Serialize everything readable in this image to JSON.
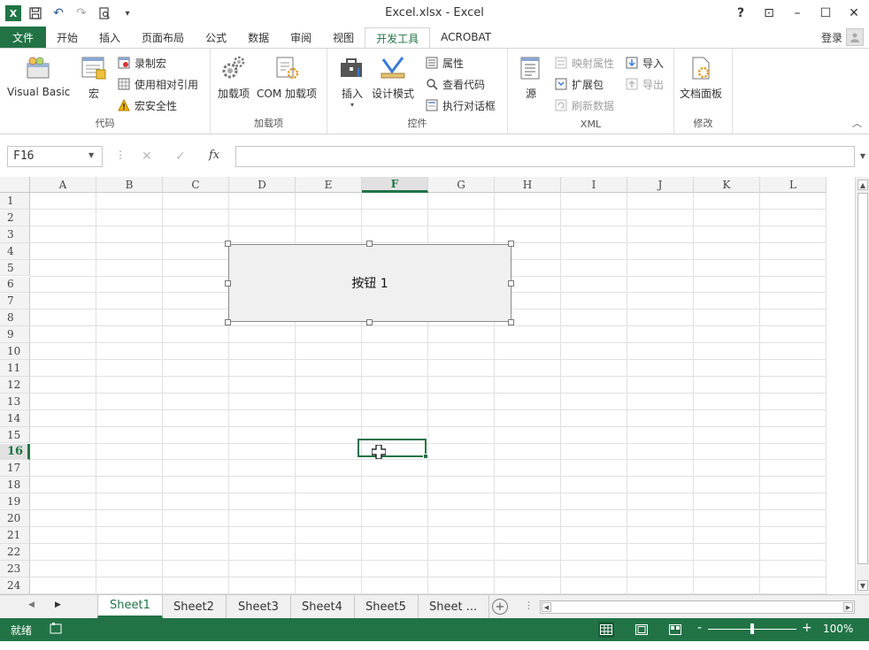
{
  "window": {
    "title": "Excel.xlsx - Excel",
    "controls": [
      "?",
      "⊡",
      "–",
      "☐",
      "✕"
    ]
  },
  "qat": {
    "app_badge": "X",
    "icons": [
      "save-icon",
      "undo-icon",
      "redo-icon",
      "print-preview-icon",
      "customize-qat-icon"
    ]
  },
  "tabs": [
    {
      "label": "文件",
      "kind": "file"
    },
    {
      "label": "开始"
    },
    {
      "label": "插入"
    },
    {
      "label": "页面布局"
    },
    {
      "label": "公式"
    },
    {
      "label": "数据"
    },
    {
      "label": "审阅"
    },
    {
      "label": "视图"
    },
    {
      "label": "开发工具",
      "active": true
    },
    {
      "label": "ACROBAT"
    }
  ],
  "account": {
    "login_label": "登录"
  },
  "ribbon": {
    "groups": {
      "code": {
        "label": "代码",
        "visual_basic": "Visual Basic",
        "macros": "宏",
        "record_macro": "录制宏",
        "relative_ref": "使用相对引用",
        "macro_security": "宏安全性"
      },
      "addins": {
        "label": "加载项",
        "addins": "加载项",
        "com_addins": "COM 加载项"
      },
      "controls": {
        "label": "控件",
        "insert": "插入",
        "design_mode": "设计模式",
        "properties": "属性",
        "view_code": "查看代码",
        "run_dialog": "执行对话框"
      },
      "xml": {
        "label": "XML",
        "source": "源",
        "map_properties": "映射属性",
        "expansion_packs": "扩展包",
        "refresh_data": "刷新数据",
        "import": "导入",
        "export": "导出"
      },
      "modify": {
        "label": "修改",
        "document_panel": "文档面板"
      }
    }
  },
  "formula_bar": {
    "name_box": "F16",
    "fx_label": "fx",
    "value": ""
  },
  "columns": [
    "A",
    "B",
    "C",
    "D",
    "E",
    "F",
    "G",
    "H",
    "I",
    "J",
    "K",
    "L"
  ],
  "active_column": "F",
  "rows": [
    "1",
    "2",
    "3",
    "4",
    "5",
    "6",
    "7",
    "8",
    "9",
    "10",
    "11",
    "12",
    "13",
    "14",
    "15",
    "16",
    "17",
    "18",
    "19",
    "20",
    "21",
    "22",
    "23",
    "24"
  ],
  "active_row": "16",
  "form_button": {
    "label": "按钮 1"
  },
  "sheets": [
    {
      "label": "Sheet1",
      "active": true
    },
    {
      "label": "Sheet2"
    },
    {
      "label": "Sheet3"
    },
    {
      "label": "Sheet4"
    },
    {
      "label": "Sheet5"
    },
    {
      "label": "Sheet ..."
    }
  ],
  "add_sheet_label": "+",
  "status": {
    "ready": "就绪",
    "zoom": "100%",
    "zoom_minus": "-",
    "zoom_plus": "+"
  },
  "colors": {
    "accent": "#217346"
  }
}
